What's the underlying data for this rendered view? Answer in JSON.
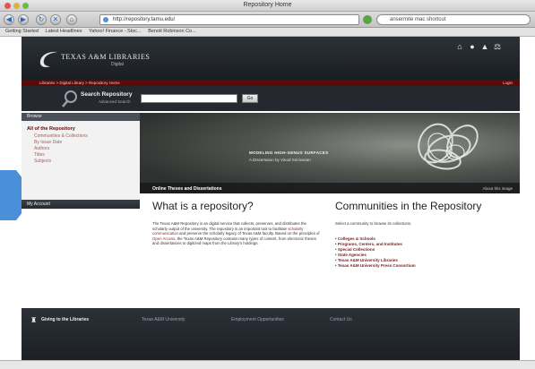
{
  "browser": {
    "window_title": "Repository Home",
    "url": "http://repository.tamu.edu/",
    "search_query": "ansermite mac shortcut",
    "bookmarks": [
      "Getting Started",
      "Latest Headlines",
      "Yahoo! Finance - Stoc...",
      "Benoit Robinson Co..."
    ]
  },
  "header": {
    "logo_title": "TEXAS A&M LIBRARIES",
    "logo_sub": "Digital",
    "icons": [
      "home-icon",
      "chat-icon",
      "user-icon",
      "tools-icon"
    ]
  },
  "breadcrumb": {
    "crumbs": "Libraries  >  Digital Library  >  Repository Home",
    "login": "Login"
  },
  "search": {
    "label": "Search Repository",
    "sub": "Advanced Search",
    "go_label": "Go"
  },
  "sidebar": {
    "browse_head": "Browse",
    "title": "All of the Repository",
    "items": [
      "Communities & Collections",
      "By Issue Date",
      "Authors",
      "Titles",
      "Subjects"
    ],
    "account_head": "My Account"
  },
  "banner": {
    "title": "MODELING HIGH-GENUS SURFACES",
    "sub": "A Dissertation by Vinod Srinivasan",
    "caption": "Online Theses and Dissertations",
    "about": "About this image"
  },
  "main": {
    "heading": "What is a repository?",
    "body_before_link1": "The Texas A&M Repository is an digital service that collects, preserves, and distributes the scholarly output of the university. The repository is an important tool to facilitate ",
    "link1": "scholarly communication",
    "body_mid": " and preserve the scholarly legacy of Texas A&M faculty. Based on the principles of ",
    "link2": "Open Access",
    "body_after": ", the Texas A&M Repository contains many types of content, from electronic theses and dissertations to digitized maps from the Library's holdings."
  },
  "communities": {
    "heading": "Communities in the Repository",
    "intro": "Select a community to browse its collections.",
    "items": [
      "Colleges & Schools",
      "Programs, Centers, and Institutes",
      "Special Collections",
      "State Agencies",
      "Texas A&M University Libraries",
      "Texas A&M University Press Consortium"
    ]
  },
  "footer": {
    "items": [
      "Giving to the Libraries",
      "Texas A&M University",
      "Employment Opportunities",
      "Contact Us"
    ]
  },
  "colors": {
    "maroon": "#5b0a0a",
    "header_dark": "#2c3138",
    "accent_blue": "#4a90d9"
  }
}
